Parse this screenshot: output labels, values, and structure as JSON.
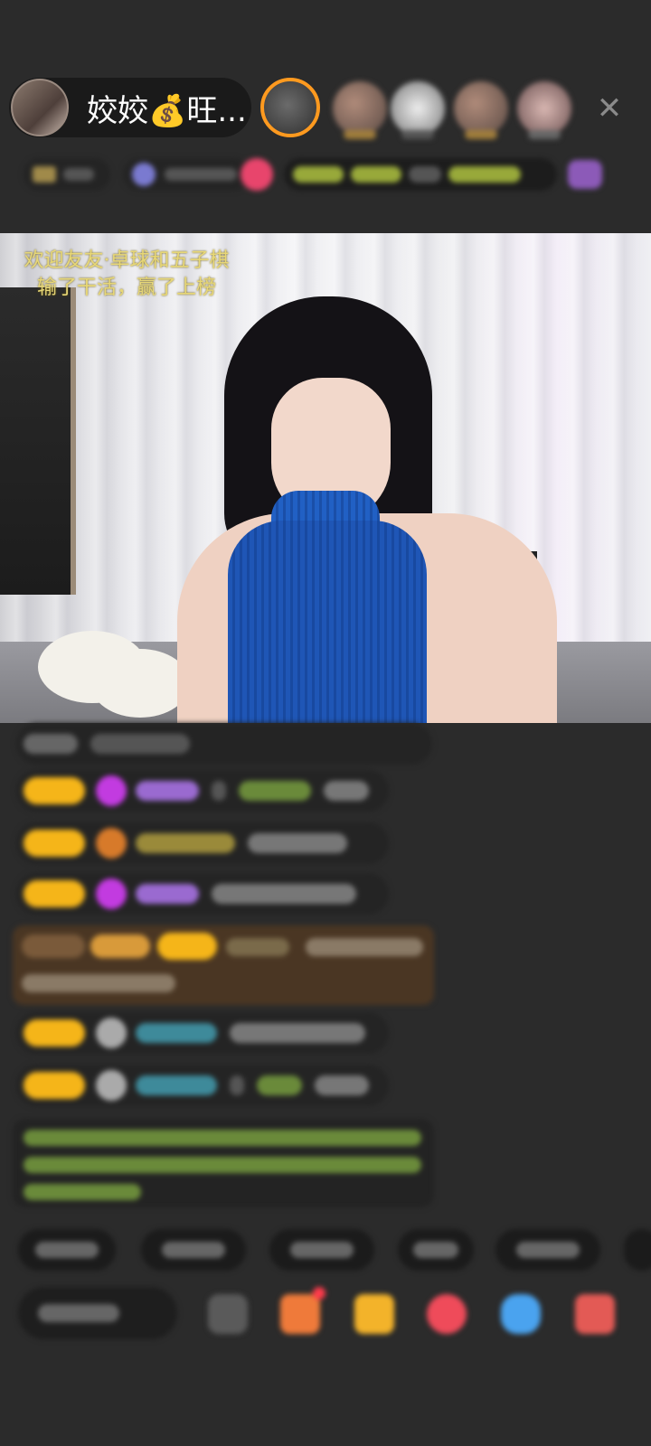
{
  "header": {
    "host_name": "姣姣💰旺...",
    "close_glyph": "✕"
  },
  "video": {
    "caption_line1": "欢迎友友·卓球和五子棋",
    "caption_line2": "输了干活，赢了上榜"
  },
  "colors": {
    "accent_orange": "#ff9a1f",
    "level_badge": "#f5b519",
    "sweater_blue": "#1f56b6",
    "caption_yellow": "#e7d777",
    "background": "#2b2b2b"
  },
  "icons": [
    "close-icon",
    "diamond-icon",
    "heart-icon",
    "ghost-icon",
    "gift-icon",
    "bag-icon",
    "game-icon"
  ]
}
